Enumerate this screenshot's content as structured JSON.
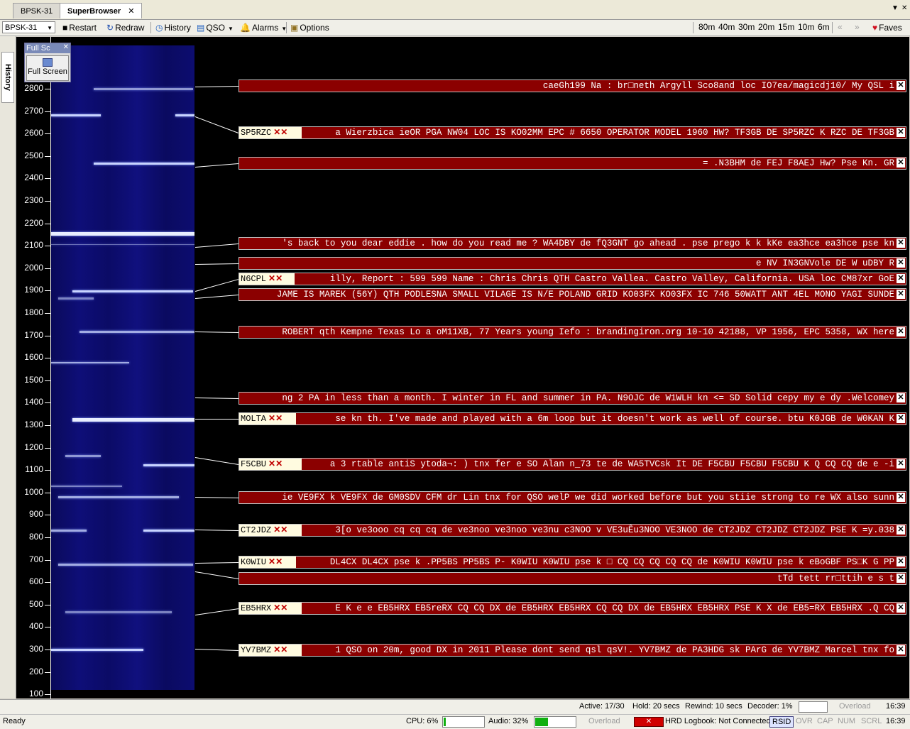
{
  "tabs": [
    {
      "label": "BPSK-31"
    },
    {
      "label": "SuperBrowser",
      "close": "✕"
    }
  ],
  "toolbar": {
    "mode_value": "BPSK-31",
    "restart": "Restart",
    "redraw": "Redraw",
    "history": "History",
    "qso": "QSO",
    "alarms": "Alarms",
    "options": "Options",
    "bands": [
      "80m",
      "40m",
      "30m",
      "20m",
      "15m",
      "10m",
      "6m"
    ],
    "faves": "Faves"
  },
  "sidebar": {
    "history_tab": "History"
  },
  "fullscreen": {
    "title": "Full Sc",
    "button": "Full Screen"
  },
  "axis_ticks": [
    "2800",
    "2700",
    "2600",
    "2500",
    "2400",
    "2300",
    "2200",
    "2100",
    "2000",
    "1900",
    "1800",
    "1700",
    "1600",
    "1500",
    "1400",
    "1300",
    "1200",
    "1100",
    "1000",
    "900",
    "800",
    "700",
    "600",
    "500",
    "400",
    "300",
    "200",
    "100"
  ],
  "messages": [
    {
      "call": "",
      "text": "caeGh199 Na : br□neth Argyll Sco8and loc IO7ea/magicdj10/ My QSL i"
    },
    {
      "call": "SP5RZC",
      "text": "a Wierzbica ieOR PGA NW04 LOC IS KO02MM EPC # 6650 OPERATOR MODEL 1960 HW? TF3GB DE SP5RZC K RZC DE TF3GB"
    },
    {
      "call": "",
      "text": "= .N3BHM de FEJ F8AEJ Hw? Pse Kn. GR"
    },
    {
      "call": "",
      "text": "'s back to you dear eddie . how do you read me ? WA4DBY de fQ3GNT go ahead . pse prego k k kKe ea3hce ea3hce pse kn"
    },
    {
      "call": "",
      "text": "e NV IN3GNVole DE W uDBY R"
    },
    {
      "call": "N6CPL",
      "text": "illy, Report : 599 599 Name : Chris Chris QTH Castro Vallea. Castro Valley, California. USA loc CM87xr GoE"
    },
    {
      "call": "",
      "text": "JAME IS MAREK (56Y) QTH PODLESNA SMALL VILAGE IS N/E POLAND GRID KO03FX KO03FX IC 746 50WATT ANT 4EL MONO YAGI SUNDE"
    },
    {
      "call": "",
      "text": "ROBERT qth Kempne Texas Lo a oM11XB, 77 Years young Iefo : brandingiron.org 10-10 42188, VP 1956, EPC 5358, WX here"
    },
    {
      "call": "",
      "text": "ng 2 PA in less than a month. I winter in FL and summer in PA. N9OJC de W1WLH kn <= SD Solid cepy my e dy .Welcomey"
    },
    {
      "call": "MOLTA",
      "text": "se kn th. I've made and played with a 6m loop but it doesn't work as well of course. btu K0JGB de W0KAN K"
    },
    {
      "call": "F5CBU",
      "text": "a 3 rtable antiS ytoda¬: ) tnx fer e SO Alan n_73 te de WA5TVCsk It DE F5CBU F5CBU F5CBU K Q CQ CQ de e -i"
    },
    {
      "call": "",
      "text": "ie VE9FX k VE9FX de GM0SDV CFM dr Lin tnx for QSO welP we did worked before but you stiie strong to re WX also sunn"
    },
    {
      "call": "CT2JDZ",
      "text": "3[o ve3ooo cq cq cq de ve3noo ve3noo ve3nu c3NOO v VE3uÊu3NOO VE3NOO de CT2JDZ CT2JDZ CT2JDZ PSE K =y.038"
    },
    {
      "call": "K0WIU",
      "text": "DL4CX DL4CX pse k .PP5BS PP5BS P- K0WIU K0WIU pse k □ CQ CQ CQ CQ CQ de K0WIU K0WIU pse k eBoGBF PS□K G PP"
    },
    {
      "call": "",
      "text": "tTd tett rr□ttih e s t"
    },
    {
      "call": "EB5HRX",
      "text": "E K e e EB5HRX EB5reRX CQ CQ DX de EB5HRX EB5HRX CQ CQ DX de EB5HRX EB5HRX PSE K X de EB5=RX EB5HRX .Q CQ"
    },
    {
      "call": "YV7BMZ",
      "text": "1 QSO on 20m, good DX in 2011 Please dont send qsl qsV!. YV7BMZ de PA3HDG sk PArG de YV7BMZ Marcel tnx fo"
    }
  ],
  "status_top": {
    "active": "Active: 17/30",
    "hold": "Hold: 20 secs",
    "rewind": "Rewind: 10 secs",
    "decoder": "Decoder: 1%",
    "overload": "Overload",
    "time": "16:39"
  },
  "status_bottom": {
    "ready": "Ready",
    "cpu": "CPU: 6%",
    "cpu_level": 0.06,
    "audio": "Audio: 32%",
    "audio_level": 0.32,
    "overload": "Overload",
    "logbook": "HRD Logbook: Not Connected",
    "rsid": "RSID",
    "ovr": "OVR",
    "cap": "CAP",
    "num": "NUM",
    "scrl": "SCRL",
    "time": "16:39"
  }
}
